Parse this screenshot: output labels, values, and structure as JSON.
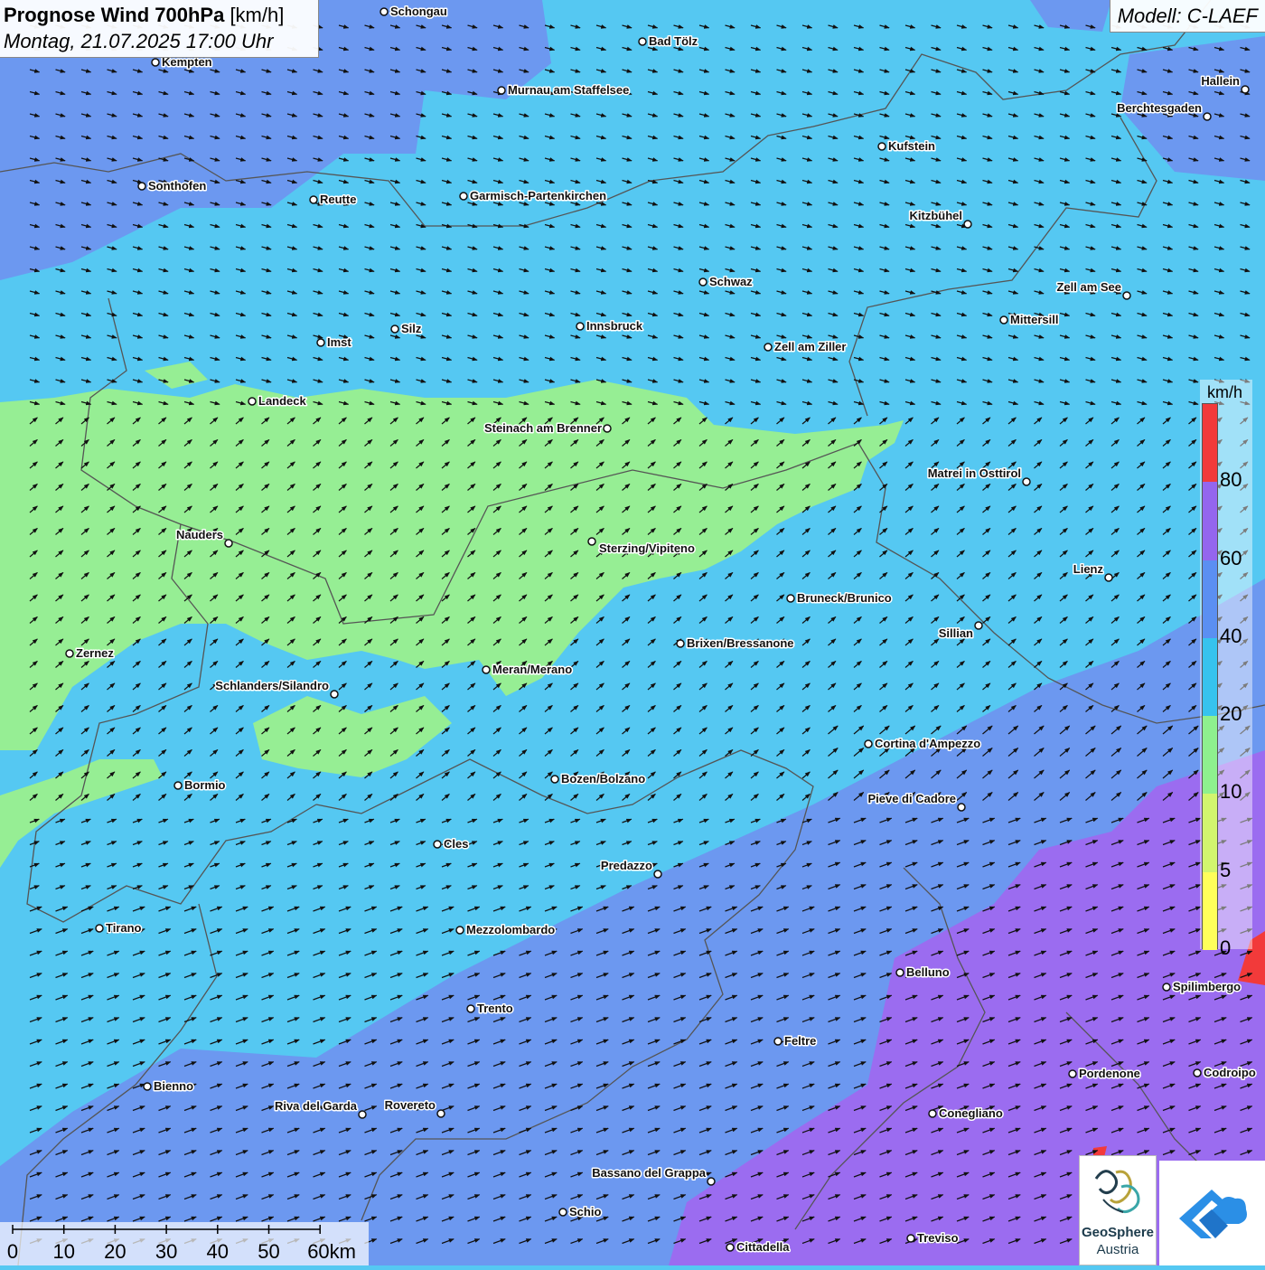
{
  "title": {
    "main": "Prognose Wind 700hPa",
    "unit": "[km/h]",
    "date": "Montag, 21.07.2025 17:00 Uhr"
  },
  "model_label": "Modell: C-LAEF",
  "legend": {
    "unit": "km/h",
    "ticks": [
      "0",
      "5",
      "10",
      "20",
      "40",
      "60",
      "80"
    ],
    "classes": [
      {
        "from": 0,
        "color": "#ffff5a"
      },
      {
        "from": 5,
        "color": "#d2f56e"
      },
      {
        "from": 10,
        "color": "#8ef08e"
      },
      {
        "from": 20,
        "color": "#36c3ee"
      },
      {
        "from": 40,
        "color": "#5b8ff2"
      },
      {
        "from": 60,
        "color": "#9466ee"
      },
      {
        "from": 80,
        "color": "#f23a3a"
      }
    ]
  },
  "scale_bar": {
    "ticks": [
      "0",
      "10",
      "20",
      "30",
      "40",
      "50",
      "60km"
    ]
  },
  "logo": {
    "line1": "GeoSphere",
    "line2": "Austria"
  },
  "cities": [
    {
      "name": "Schongau"
    },
    {
      "name": "Bad Tölz"
    },
    {
      "name": "Kempten"
    },
    {
      "name": "Murnau am Staffelsee"
    },
    {
      "name": "Hallein"
    },
    {
      "name": "Berchtesgaden"
    },
    {
      "name": "Kufstein"
    },
    {
      "name": "Sonthofen"
    },
    {
      "name": "Reutte"
    },
    {
      "name": "Garmisch-Partenkirchen"
    },
    {
      "name": "Kitzbühel"
    },
    {
      "name": "Schwaz"
    },
    {
      "name": "Zell am See"
    },
    {
      "name": "Mittersill"
    },
    {
      "name": "Silz"
    },
    {
      "name": "Innsbruck"
    },
    {
      "name": "Imst"
    },
    {
      "name": "Zell am Ziller"
    },
    {
      "name": "Landeck"
    },
    {
      "name": "Steinach am Brenner"
    },
    {
      "name": "Matrei in Osttirol"
    },
    {
      "name": "Nauders"
    },
    {
      "name": "Sterzing/Vipiteno"
    },
    {
      "name": "Lienz"
    },
    {
      "name": "Bruneck/Brunico"
    },
    {
      "name": "Sillian"
    },
    {
      "name": "Zernez"
    },
    {
      "name": "Brixen/Bressanone"
    },
    {
      "name": "Meran/Merano"
    },
    {
      "name": "Schlanders/Silandro"
    },
    {
      "name": "Cortina d'Ampezzo"
    },
    {
      "name": "Bormio"
    },
    {
      "name": "Bozen/Bolzano"
    },
    {
      "name": "Pieve di Cadore"
    },
    {
      "name": "Cles"
    },
    {
      "name": "Predazzo"
    },
    {
      "name": "Tirano"
    },
    {
      "name": "Mezzolombardo"
    },
    {
      "name": "Belluno"
    },
    {
      "name": "Spilimbergo"
    },
    {
      "name": "Trento"
    },
    {
      "name": "Feltre"
    },
    {
      "name": "Pordenone"
    },
    {
      "name": "Codroipo"
    },
    {
      "name": "Bienno"
    },
    {
      "name": "Riva del Garda"
    },
    {
      "name": "Rovereto"
    },
    {
      "name": "Conegliano"
    },
    {
      "name": "Bassano del Grappa"
    },
    {
      "name": "Schio"
    },
    {
      "name": "Treviso"
    },
    {
      "name": "Cittadella"
    }
  ]
}
